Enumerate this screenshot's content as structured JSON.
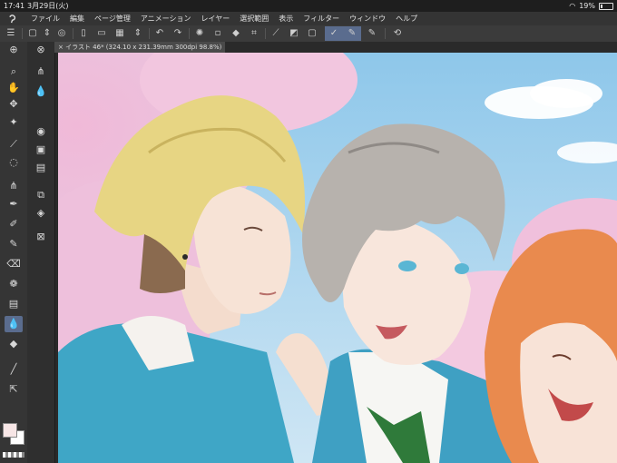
{
  "status": {
    "time": "17:41",
    "date": "3月29日(火)",
    "battery": "19%",
    "battery_level": 0.19
  },
  "menu": {
    "items": [
      "ファイル",
      "編集",
      "ページ管理",
      "アニメーション",
      "レイヤー",
      "選択範囲",
      "表示",
      "フィルター",
      "ウィンドウ",
      "ヘルプ"
    ]
  },
  "document": {
    "tab_title": "イラスト 46* (324.10 x 231.39mm 300dpi 98.8%)"
  },
  "colors": {
    "main": "#f7e6e6",
    "sub": "#ffffff",
    "accent": "#5a6c8e"
  },
  "toolbar_icons": [
    "menu-icon",
    "new-canvas-icon",
    "resize-icon",
    "save-icon",
    "new-file-icon",
    "open-file-icon",
    "transparency-icon",
    "snap-icon",
    "undo-icon",
    "redo-icon",
    "spin-icon",
    "clear-icon",
    "fill-icon",
    "crop-icon",
    "lasso-icon",
    "tone-icon",
    "frame-icon",
    "select-pen-icon",
    "select-erase-icon",
    "draw-icon",
    "help-icon"
  ],
  "tool_icons": [
    "zoom-icon",
    "hand-icon",
    "move-icon",
    "magic-wand-icon",
    "eyedropper-icon",
    "lasso-icon",
    "brush-icon",
    "pen-icon",
    "pencil-icon",
    "marker-icon",
    "eraser-icon",
    "decorate-icon",
    "gradient-icon",
    "blend-icon",
    "fill-icon",
    "line-icon",
    "text-icon"
  ]
}
